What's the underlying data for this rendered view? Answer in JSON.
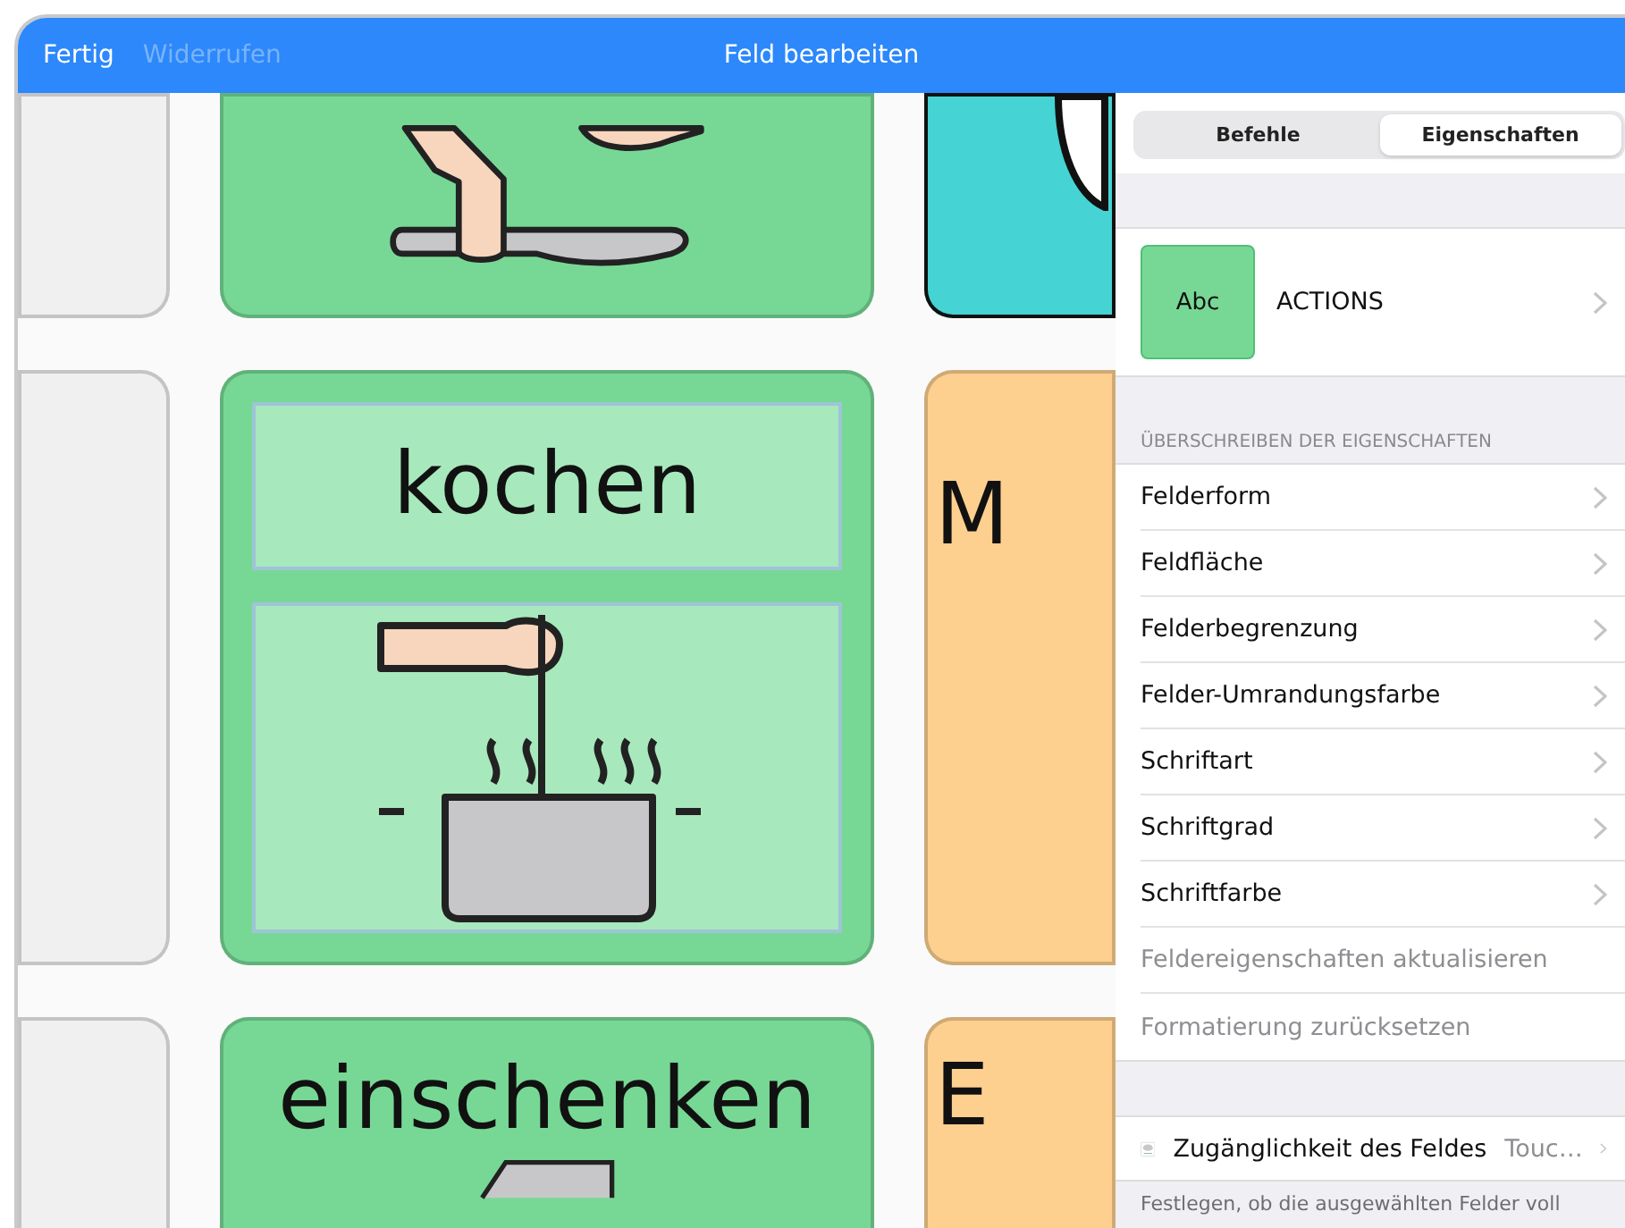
{
  "header": {
    "done": "Fertig",
    "undo": {
      "label": "Widerrufen",
      "disabled": true
    },
    "title": "Feld bearbeiten"
  },
  "tiles": [
    {
      "kind": "blank",
      "color": "#f0f0f0"
    },
    {
      "kind": "knife",
      "color": "#77d895"
    },
    {
      "kind": "speech",
      "color": "#45d3d3"
    },
    {
      "kind": "blank",
      "color": "#f0f0f0"
    },
    {
      "kind": "pot",
      "color": "#77d895",
      "label": "kochen",
      "selected": true
    },
    {
      "kind": "text",
      "color": "#fdd08f",
      "label": "M"
    },
    {
      "kind": "blank",
      "color": "#f0f0f0"
    },
    {
      "kind": "jug",
      "color": "#77d895",
      "label": "einschenken",
      "selected": false
    },
    {
      "kind": "text",
      "color": "#fdd08f",
      "label": "E"
    }
  ],
  "panel": {
    "tabs": [
      {
        "label": "Befehle",
        "selected": false
      },
      {
        "label": "Eigenschaften",
        "selected": true
      }
    ],
    "preview": {
      "swatch": "Abc",
      "name": "ACTIONS"
    },
    "section_header": "ÜBERSCHREIBEN DER EIGENSCHAFTEN",
    "items": [
      {
        "label": "Felderform",
        "kind": "nav"
      },
      {
        "label": "Feldfläche",
        "kind": "nav"
      },
      {
        "label": "Felderbegrenzung",
        "kind": "nav"
      },
      {
        "label": "Felder-Umrandungsfarbe",
        "kind": "nav"
      },
      {
        "label": "Schriftart",
        "kind": "nav"
      },
      {
        "label": "Schriftgrad",
        "kind": "nav"
      },
      {
        "label": "Schriftfarbe",
        "kind": "nav"
      },
      {
        "label": "Feldereigenschaften aktualisieren",
        "kind": "action"
      },
      {
        "label": "Formatierung zurücksetzen",
        "kind": "action"
      }
    ],
    "accessibility": {
      "label": "Zugänglichkeit des Feldes",
      "value": "Touc…"
    },
    "footer": "Festlegen, ob die ausgewählten Felder voll"
  }
}
